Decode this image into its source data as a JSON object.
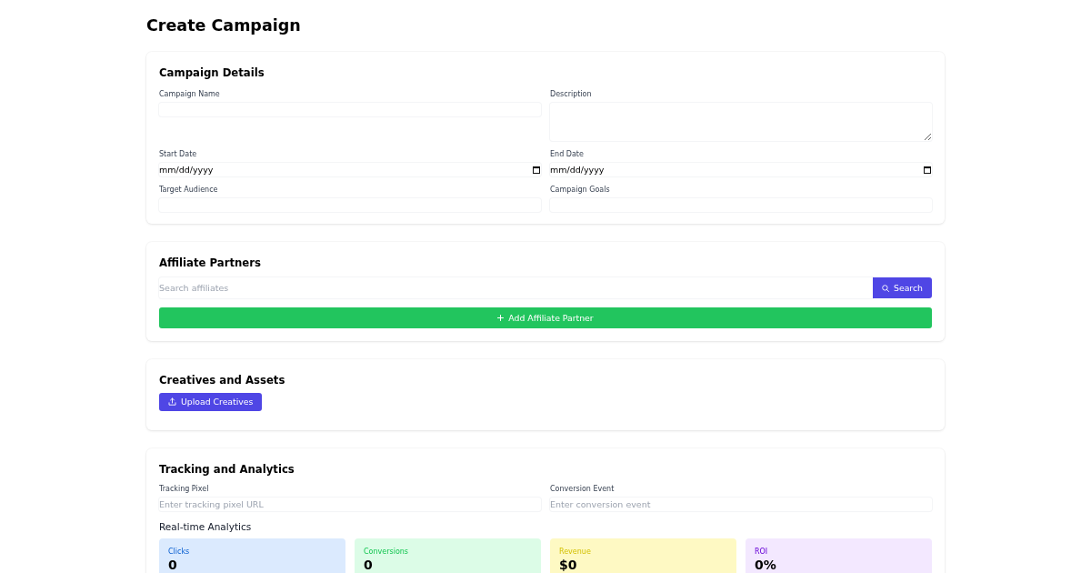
{
  "title": "Create Campaign",
  "campaign_details": {
    "title": "Campaign Details",
    "fields": [
      {
        "label": "Campaign Name",
        "kind": "text"
      },
      {
        "label": "Description",
        "kind": "textarea"
      },
      {
        "label": "Start Date",
        "kind": "date",
        "value": "mm/dd/yyyy"
      },
      {
        "label": "End Date",
        "kind": "date",
        "value": "mm/dd/yyyy"
      },
      {
        "label": "Target Audience",
        "kind": "text"
      },
      {
        "label": "Campaign Goals",
        "kind": "text"
      }
    ]
  },
  "affiliate_partners": {
    "title": "Affiliate Partners",
    "search": {
      "placeholder": "Search affiliates",
      "button": "Search"
    },
    "add_button": "Add Affiliate Partner"
  },
  "creatives": {
    "title": "Creatives and Assets",
    "upload_button": "Upload Creatives"
  },
  "tracking": {
    "title": "Tracking and Analytics",
    "fields": [
      {
        "label": "Tracking Pixel",
        "kind": "text",
        "placeholder": "Enter tracking pixel URL"
      },
      {
        "label": "Conversion Event",
        "kind": "text",
        "placeholder": "Enter conversion event"
      }
    ],
    "analytics": {
      "title": "Real-time Analytics",
      "stats": [
        {
          "label": "Clicks",
          "value": "0",
          "color": "#dbeafe"
        },
        {
          "label": "Conversions",
          "value": "0",
          "color": "#dcfce7"
        },
        {
          "label": "Revenue",
          "value": "$0",
          "color": "#fef9c3"
        },
        {
          "label": "ROI",
          "value": "0%",
          "color": "#f3e8ff"
        }
      ]
    }
  }
}
